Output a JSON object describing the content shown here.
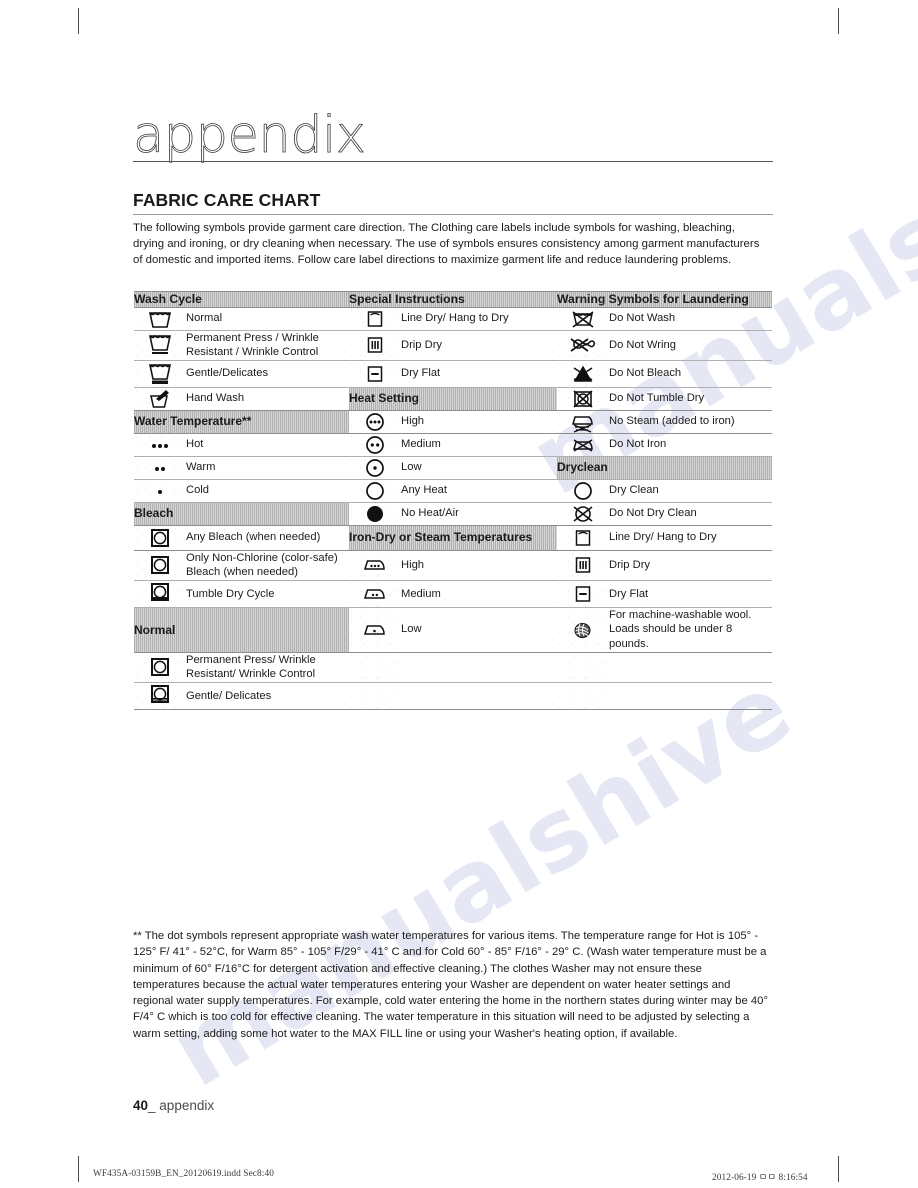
{
  "chapter": {
    "title": "appendix"
  },
  "section": {
    "heading": "FABRIC CARE CHART",
    "intro": "The following symbols provide garment care direction. The Clothing care labels include symbols for washing, bleaching, drying and ironing, or dry cleaning when necessary. The use of symbols ensures consistency among garment manufacturers of domestic and imported items. Follow care label directions to maximize garment life and reduce laundering problems."
  },
  "table": {
    "headers": {
      "col1": "Wash Cycle",
      "col2": "Special Instructions",
      "col3": "Warning Symbols for Laundering"
    },
    "section_labels": {
      "water_temperature": "Water Temperature**",
      "bleach": "Bleach",
      "normal": "Normal",
      "heat_setting": "Heat Setting",
      "iron_dry_or_steam": "Iron-Dry or Steam Temperatures",
      "dryclean": "Dryclean"
    },
    "column1": [
      {
        "icon": "washtub-icon",
        "label": "Normal"
      },
      {
        "icon": "washtub-one-bar-icon",
        "label": "Permanent Press / Wrinkle Resistant / Wrinkle Control"
      },
      {
        "icon": "washtub-two-bar-icon",
        "label": "Gentle/Delicates"
      },
      {
        "icon": "hand-wash-icon",
        "label": "Hand Wash"
      },
      {
        "icon": "three-dots-icon",
        "label": "Hot"
      },
      {
        "icon": "two-dots-icon",
        "label": "Warm"
      },
      {
        "icon": "one-dot-icon",
        "label": "Cold"
      },
      {
        "icon": "dryer-icon",
        "label": "Any Bleach (when needed)"
      },
      {
        "icon": "dryer-icon",
        "label": "Only Non-Chlorine (color-safe) Bleach (when needed)"
      },
      {
        "icon": "dryer-one-bar-icon",
        "label": "Tumble Dry Cycle"
      },
      {
        "icon": "dryer-icon",
        "label": "Permanent Press/ Wrinkle Resistant/ Wrinkle Control"
      },
      {
        "icon": "dryer-two-bar-icon",
        "label": "Gentle/ Delicates"
      }
    ],
    "column2": [
      {
        "icon": "line-dry-icon",
        "label": "Line Dry/ Hang to Dry"
      },
      {
        "icon": "drip-dry-icon",
        "label": "Drip Dry"
      },
      {
        "icon": "dry-flat-icon",
        "label": "Dry Flat"
      },
      {
        "icon": "circle-three-dots-icon",
        "label": "High"
      },
      {
        "icon": "circle-two-dots-icon",
        "label": "Medium"
      },
      {
        "icon": "circle-one-dot-icon",
        "label": "Low"
      },
      {
        "icon": "circle-empty-icon",
        "label": "Any Heat"
      },
      {
        "icon": "circle-filled-icon",
        "label": "No Heat/Air"
      },
      {
        "icon": "iron-three-dots-icon",
        "label": "High"
      },
      {
        "icon": "iron-two-dots-icon",
        "label": "Medium"
      },
      {
        "icon": "iron-one-dot-icon",
        "label": "Low"
      }
    ],
    "column3": [
      {
        "icon": "do-not-wash-icon",
        "label": "Do Not Wash"
      },
      {
        "icon": "do-not-wring-icon",
        "label": "Do Not Wring"
      },
      {
        "icon": "do-not-bleach-icon",
        "label": "Do Not Bleach"
      },
      {
        "icon": "do-not-tumble-dry-icon",
        "label": "Do Not Tumble Dry"
      },
      {
        "icon": "no-steam-icon",
        "label": "No Steam (added to iron)"
      },
      {
        "icon": "do-not-iron-icon",
        "label": "Do Not Iron"
      },
      {
        "icon": "dry-clean-icon",
        "label": "Dry Clean"
      },
      {
        "icon": "do-not-dry-clean-icon",
        "label": "Do Not Dry Clean"
      },
      {
        "icon": "line-dry-icon",
        "label": "Line Dry/ Hang to Dry"
      },
      {
        "icon": "drip-dry-icon",
        "label": "Drip Dry"
      },
      {
        "icon": "dry-flat-icon",
        "label": "Dry Flat"
      },
      {
        "icon": "wool-icon",
        "label": "For machine-washable wool. Loads should be under 8 pounds."
      }
    ]
  },
  "footnote": {
    "text": "** The dot symbols represent appropriate wash water temperatures for various items. The temperature range for Hot is 105° - 125° F/ 41° - 52°C, for Warm 85° - 105° F/29° - 41° C and for Cold 60° - 85° F/16° - 29° C. (Wash water temperature must be a minimum of 60° F/16°C for detergent activation and effective cleaning.) The clothes Washer may not ensure these temperatures because the actual water temperatures entering your Washer are dependent on water heater settings and regional water supply temperatures. For example, cold water entering the home in the northern states during winter may be 40° F/4° C which is too cold for effective cleaning. The water temperature in this situation will need to be adjusted by selecting a warm setting, adding some hot water to the MAX FILL line or using your Washer's heating option, if available."
  },
  "page_footer": {
    "page_number": "40",
    "page_label": "appendix"
  },
  "print_footer": {
    "file": "WF435A-03159B_EN_20120619.indd   Sec8:40",
    "timestamp": "2012-06-19   ㅁㅁ 8:16:54"
  },
  "watermark": {
    "line1": "manualshive.com",
    "line2": "manualshive"
  },
  "colors": {
    "band": "#d6d6d6",
    "rule": "#8d8d8d",
    "text": "#1c1c1c"
  }
}
